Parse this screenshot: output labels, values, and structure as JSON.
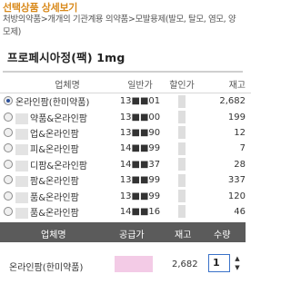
{
  "title": "선택상품 상세보기",
  "breadcrumb": "처방의약품>개개의 기관계용 의약품>모발용제(발모, 탈모, 염모, 양모제)",
  "product_name": "프로페시아정(팩) 1mg",
  "table": {
    "headers": [
      "업체명",
      "일반가",
      "할인가",
      "재고"
    ],
    "rows": [
      {
        "selected": true,
        "name": "온라인팜(한미약품)",
        "price": "13■■01",
        "stock": "2,682"
      },
      {
        "selected": false,
        "name": "약품&온라인팜",
        "price": "13■■00",
        "stock": "199"
      },
      {
        "selected": false,
        "name": "업&온라인팜",
        "price": "13■■90",
        "stock": "12"
      },
      {
        "selected": false,
        "name": "피&온라인팜",
        "price": "14■■99",
        "stock": "7"
      },
      {
        "selected": false,
        "name": "디팜&온라인팜",
        "price": "14■■37",
        "stock": "28"
      },
      {
        "selected": false,
        "name": "팜&온라인팜",
        "price": "13■■99",
        "stock": "337"
      },
      {
        "selected": false,
        "name": "품&온라인팜",
        "price": "13■■99",
        "stock": "120"
      },
      {
        "selected": false,
        "name": "품&온라인팜",
        "price": "14■■16",
        "stock": "46"
      }
    ]
  },
  "footer": {
    "headers": {
      "vendor": "업체명",
      "price": "공급가",
      "stock": "재고",
      "qty": "수량"
    },
    "vendor": "온라인팜(한미약품)",
    "stock": "2,682",
    "quantity": "1",
    "spin_up": "▲",
    "spin_down": "▼"
  }
}
